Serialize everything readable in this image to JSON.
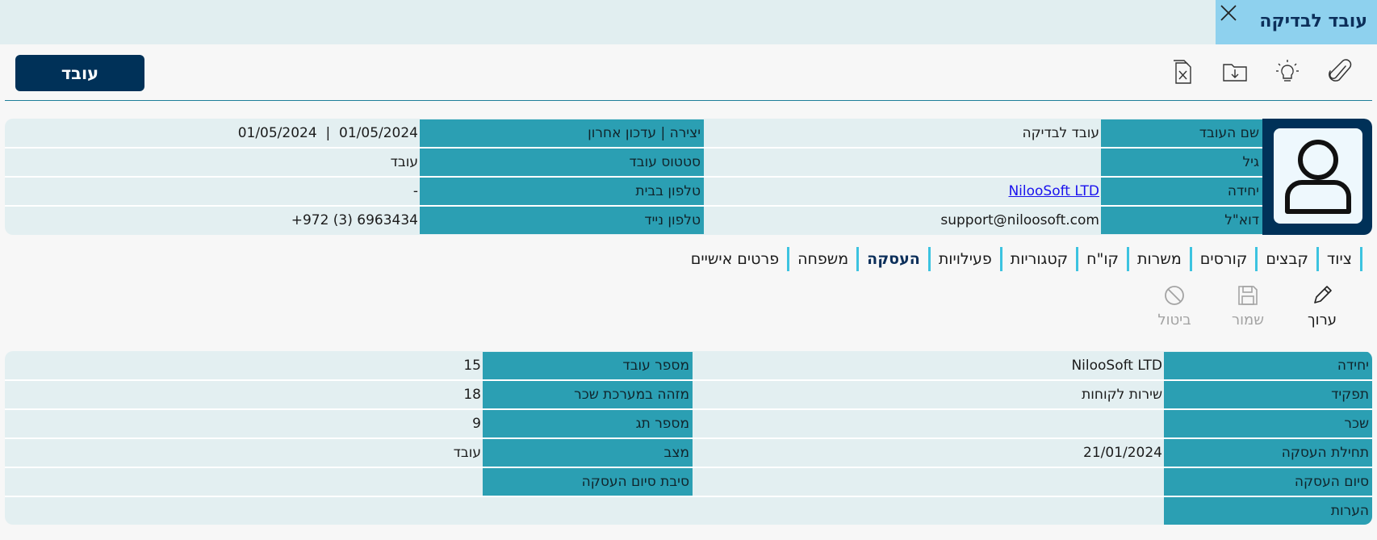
{
  "window": {
    "title": "עובד לבדיקה"
  },
  "toolbar": {
    "main_button": "עובד"
  },
  "header": {
    "name_label": "שם העובד",
    "name_value": "עובד לבדיקה",
    "age_label": "גיל",
    "age_value": "",
    "unit_label": "יחידה",
    "unit_value": "NilooSoft LTD",
    "email_label": "דוא\"ל",
    "email_value": "support@niloosoft.com",
    "created_label": "יצירה | עדכון אחרון",
    "created_value": "01/05/2024  |  01/05/2024",
    "status_label": "סטטוס עובד",
    "status_value": "עובד",
    "home_phone_label": "טלפון בבית",
    "home_phone_value": "-",
    "mobile_label": "טלפון נייד",
    "mobile_value": "+972 (3) 6963434"
  },
  "tabs": [
    {
      "label": "פרטים אישיים"
    },
    {
      "label": "משפחה"
    },
    {
      "label": "העסקה"
    },
    {
      "label": "פעילויות"
    },
    {
      "label": "קטגוריות"
    },
    {
      "label": "קו\"ח"
    },
    {
      "label": "משרות"
    },
    {
      "label": "קורסים"
    },
    {
      "label": "קבצים"
    },
    {
      "label": "ציוד"
    }
  ],
  "active_tab": "העסקה",
  "actions": {
    "edit": "ערוך",
    "save": "שמור",
    "cancel": "ביטול"
  },
  "employment": {
    "unit_label": "יחידה",
    "unit_value": "NilooSoft LTD",
    "role_label": "תפקיד",
    "role_value": "שירות לקוחות",
    "salary_label": "שכר",
    "salary_value": "",
    "start_label": "תחילת העסקה",
    "start_value": "21/01/2024",
    "end_label": "סיום העסקה",
    "end_value": "",
    "notes_label": "הערות",
    "notes_value": "",
    "emp_no_label": "מספר עובד",
    "emp_no_value": "15",
    "payroll_label": "מזהה במערכת שכר",
    "payroll_value": "18",
    "tag_label": "מספר תג",
    "tag_value": "9",
    "state_label": "מצב",
    "state_value": "עובד",
    "end_reason_label": "סיבת סיום העסקה",
    "end_reason_value": ""
  },
  "colors": {
    "navy": "#003158",
    "teal": "#2b9fb3",
    "accent": "#3cc3e0",
    "title_tab": "#8ed1ee"
  }
}
